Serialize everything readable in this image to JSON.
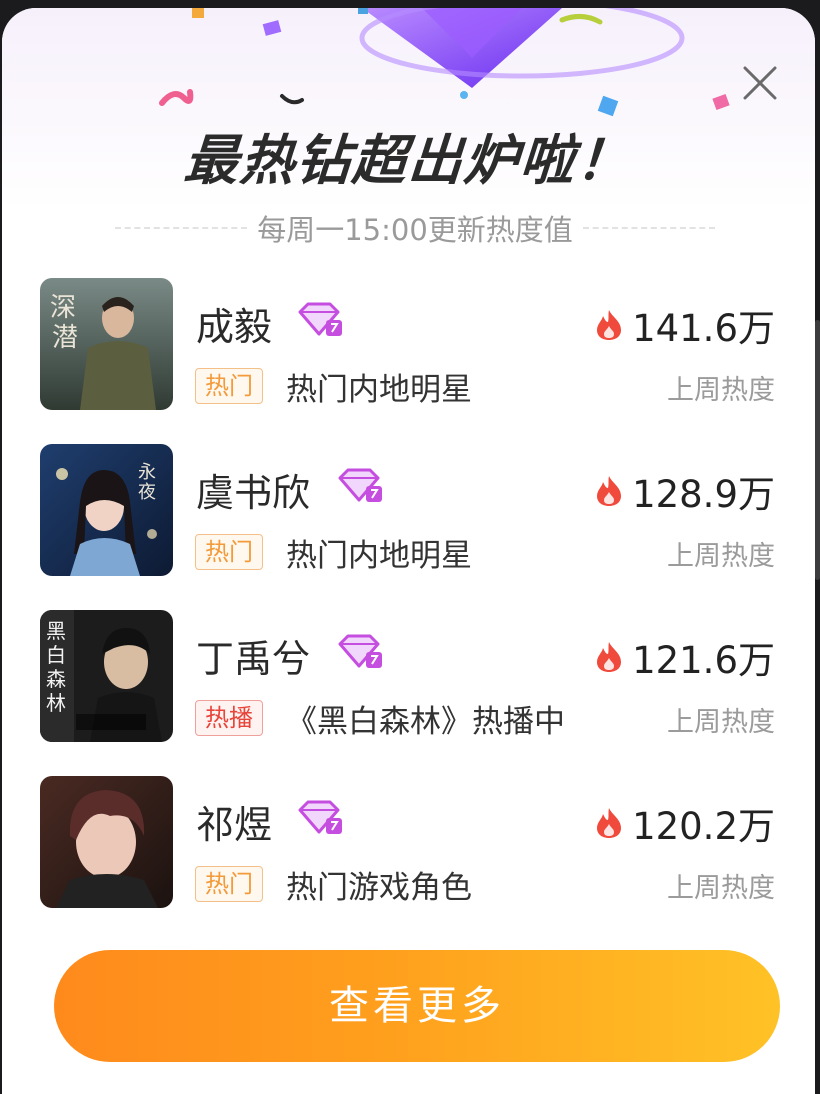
{
  "dialog": {
    "title": "最热钻超出炉啦！",
    "subtitle": "每周一15:00更新热度值",
    "more_button_label": "查看更多"
  },
  "colors": {
    "hot_tag": "#f39a3a",
    "airing_tag": "#e8443a",
    "flame": "#f04a3c",
    "diamond": "#c54ee0",
    "button_start": "#ff8a1c",
    "button_end": "#ffc226"
  },
  "stars": [
    {
      "name": "成毅",
      "tag": "热门",
      "tag_type": "hot",
      "desc": "热门内地明星",
      "heat": "141.6万",
      "heat_label": "上周热度",
      "icon": "diamond-badge-icon"
    },
    {
      "name": "虞书欣",
      "tag": "热门",
      "tag_type": "hot",
      "desc": "热门内地明星",
      "heat": "128.9万",
      "heat_label": "上周热度",
      "icon": "diamond-badge-icon"
    },
    {
      "name": "丁禹兮",
      "tag": "热播",
      "tag_type": "airing",
      "desc": "《黑白森林》热播中",
      "heat": "121.6万",
      "heat_label": "上周热度",
      "icon": "diamond-badge-icon"
    },
    {
      "name": "祁煜",
      "tag": "热门",
      "tag_type": "hot",
      "desc": "热门游戏角色",
      "heat": "120.2万",
      "heat_label": "上周热度",
      "icon": "diamond-badge-icon"
    }
  ]
}
